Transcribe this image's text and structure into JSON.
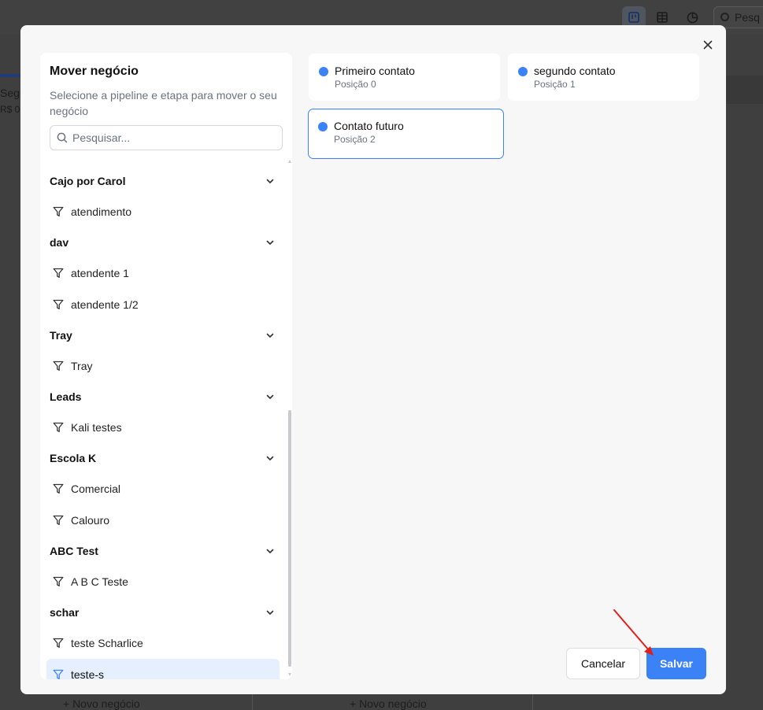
{
  "background": {
    "column_title": "Segu",
    "column_subtitle": "R$ 0,",
    "search_placeholder": "Pesq",
    "new_deal_label": "+ Novo negócio",
    "icons": [
      "kanban-icon",
      "table-icon",
      "pie-chart-icon",
      "search-icon"
    ]
  },
  "modal": {
    "title": "Mover negócio",
    "description": "Selecione a pipeline e etapa para mover o seu negócio",
    "search_placeholder": "Pesquisar...",
    "search_value": "",
    "pipelines": [
      {
        "name": "Cajo por Carol",
        "stages": [
          "atendimento"
        ]
      },
      {
        "name": "dav",
        "stages": [
          "atendente 1",
          "atendente 1/2"
        ]
      },
      {
        "name": "Tray",
        "stages": [
          "Tray"
        ]
      },
      {
        "name": "Leads",
        "stages": [
          "Kali testes"
        ]
      },
      {
        "name": "Escola K",
        "stages": [
          "Comercial",
          "Calouro"
        ]
      },
      {
        "name": "ABC Test",
        "stages": [
          "A B C Teste"
        ]
      },
      {
        "name": "schar",
        "stages": [
          "teste Scharlice",
          "teste-s"
        ]
      }
    ],
    "selected_stage": "teste-s",
    "pipeline_stages": [
      {
        "name": "Primeiro contato",
        "position": "Posição 0",
        "color": "#3b82f6"
      },
      {
        "name": "segundo contato",
        "position": "Posição 1",
        "color": "#3b82f6"
      },
      {
        "name": "Contato futuro",
        "position": "Posição 2",
        "color": "#3b82f6"
      }
    ],
    "selected_pipeline_stage": "Contato futuro",
    "cancel_label": "Cancelar",
    "save_label": "Salvar"
  },
  "colors": {
    "accent": "#3b82f6",
    "selected_bg": "#e6effd",
    "annotation_arrow": "#e0201b"
  }
}
